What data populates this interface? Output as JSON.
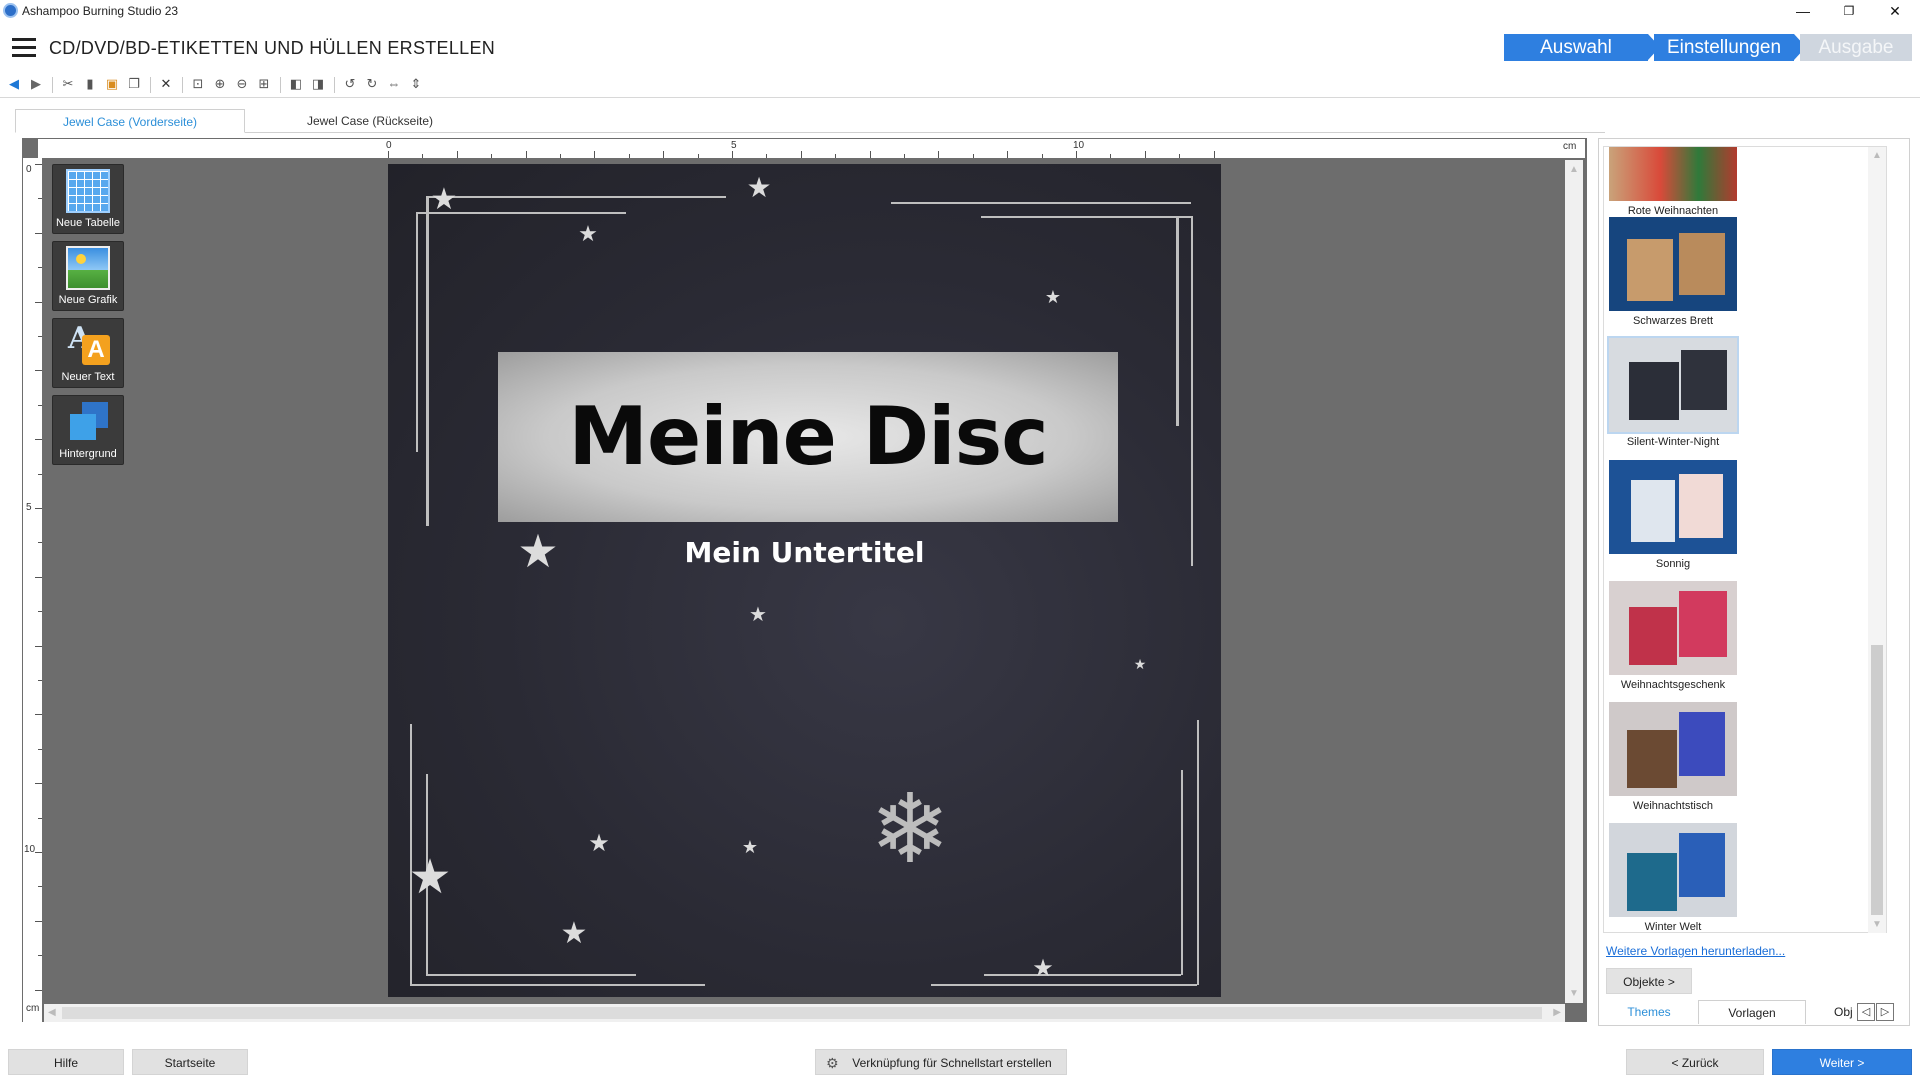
{
  "window": {
    "title": "Ashampoo Burning Studio 23",
    "controls": [
      "—",
      "❐",
      "✕"
    ]
  },
  "header": {
    "page_title": "CD/DVD/BD-ETIKETTEN UND HÜLLEN ERSTELLEN",
    "steps": [
      {
        "label": "Auswahl",
        "state": "active"
      },
      {
        "label": "Einstellungen",
        "state": "active"
      },
      {
        "label": "Ausgabe",
        "state": "inactive"
      }
    ]
  },
  "toolbar": {
    "icons": [
      "back-icon",
      "forward-icon",
      "cut-icon",
      "delete-icon",
      "paste-icon",
      "copy-icon",
      "remove-icon",
      "zoom-fit-icon",
      "zoom-in-icon",
      "zoom-out-icon",
      "zoom-page-icon",
      "bring-front-icon",
      "send-back-icon",
      "rotate-left-icon",
      "rotate-right-icon",
      "flip-horizontal-icon",
      "flip-vertical-icon"
    ]
  },
  "tabs": [
    {
      "label": "Jewel Case (Vorderseite)",
      "selected": true
    },
    {
      "label": "Jewel Case (Rückseite)",
      "selected": false
    }
  ],
  "ruler": {
    "top_labels": [
      "0",
      "5",
      "10"
    ],
    "unit": "cm",
    "left_labels": [
      "0",
      "5",
      "10"
    ]
  },
  "tools": [
    {
      "label": "Neue Tabelle",
      "icon": "table-icon"
    },
    {
      "label": "Neue Grafik",
      "icon": "image-icon"
    },
    {
      "label": "Neuer Text",
      "icon": "text-icon"
    },
    {
      "label": "Hintergrund",
      "icon": "background-icon"
    }
  ],
  "canvas": {
    "title": "Meine Disc",
    "subtitle": "Mein Untertitel"
  },
  "templates": {
    "items": [
      {
        "label": "Rote Weihnachten",
        "color": "#b33a2e"
      },
      {
        "label": "Schwarzes Brett",
        "color": "#16457e"
      },
      {
        "label": "Silent-Winter-Night",
        "color": "#8b93a0"
      },
      {
        "label": "Sonnig",
        "color": "#1d5296"
      },
      {
        "label": "Weihnachtsgeschenk",
        "color": "#d8d0d0"
      },
      {
        "label": "Weihnachtstisch",
        "color": "#cfc9c9"
      },
      {
        "label": "Winter Welt",
        "color": "#d2d6dc"
      }
    ],
    "more_link": "Weitere Vorlagen herunterladen...",
    "objects_button": "Objekte >",
    "panel_tabs": [
      "Themes",
      "Vorlagen",
      "Obj"
    ]
  },
  "footer": {
    "help": "Hilfe",
    "home": "Startseite",
    "shortcut": "Verknüpfung für Schnellstart erstellen",
    "back": "< Zurück",
    "next": "Weiter >"
  },
  "colors": {
    "accent": "#2e7fe0",
    "link": "#1a6ed8",
    "canvas_bg": "#2a2a34"
  }
}
